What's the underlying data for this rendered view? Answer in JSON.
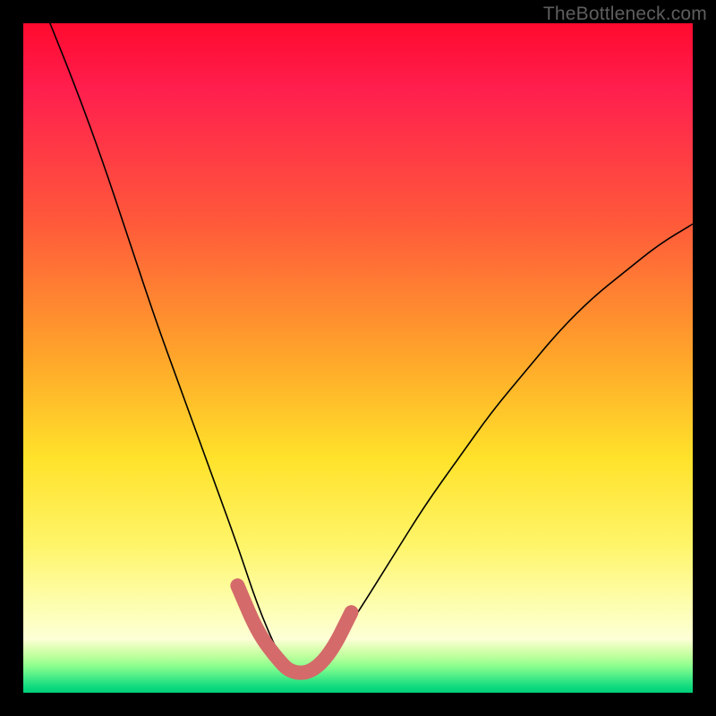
{
  "watermark": "TheBottleneck.com",
  "chart_data": {
    "type": "line",
    "title": "",
    "xlabel": "",
    "ylabel": "",
    "xlim": [
      0,
      100
    ],
    "ylim": [
      0,
      100
    ],
    "grid": false,
    "legend": false,
    "series": [
      {
        "name": "bottleneck-curve",
        "note": "Approximate V-shaped bottleneck curve; percentages of plot area (0=left/bottom, 100=right/top). Minimum near x≈40 at y≈3.",
        "x": [
          4,
          8,
          12,
          16,
          20,
          24,
          28,
          32,
          35,
          38,
          40,
          43,
          46,
          50,
          55,
          60,
          65,
          70,
          75,
          80,
          85,
          90,
          95,
          100
        ],
        "y": [
          100,
          90,
          79,
          67,
          55,
          44,
          33,
          22,
          13,
          6,
          3,
          3,
          6,
          12,
          20,
          28,
          35,
          42,
          48,
          54,
          59,
          63,
          67,
          70
        ]
      },
      {
        "name": "optimal-range-highlight",
        "note": "Thick warm-red segment marking the trough / optimal region of the curve.",
        "x": [
          32,
          35,
          38,
          40,
          43,
          46,
          49
        ],
        "y": [
          16,
          9,
          5,
          3,
          3,
          6,
          12
        ]
      }
    ]
  }
}
